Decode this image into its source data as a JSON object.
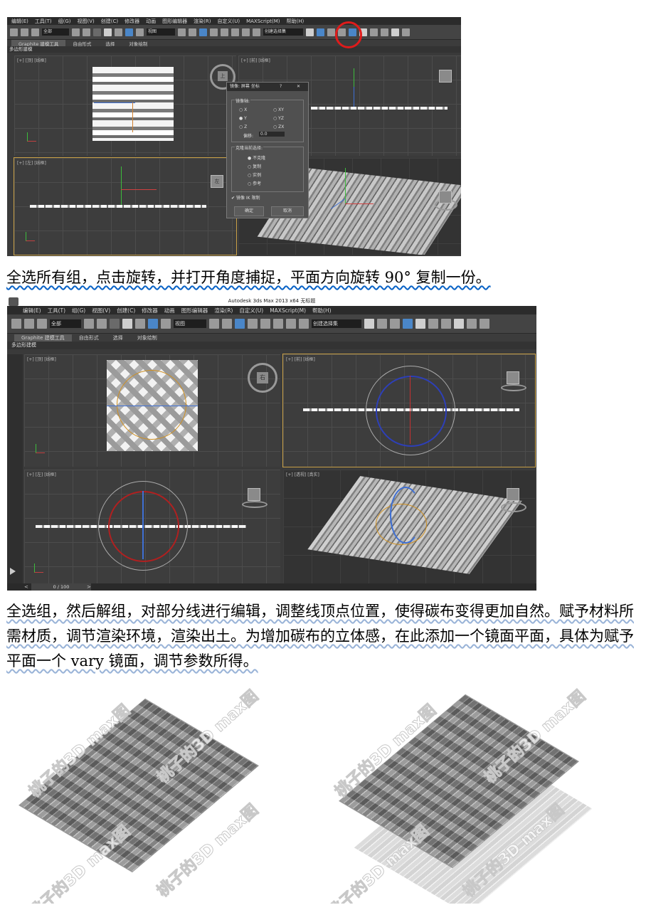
{
  "screenshot1": {
    "menu": [
      "编辑(E)",
      "工具(T)",
      "组(G)",
      "视图(V)",
      "创建(C)",
      "修改器",
      "动画",
      "图形编辑器",
      "渲染(R)",
      "自定义(U)",
      "MAXScript(M)",
      "帮助(H)"
    ],
    "toolbar": {
      "filter_value": "全部",
      "view_value": "视图",
      "selection_set_value": "创建选择集"
    },
    "ribbon_tabs": [
      "Graphite 建模工具",
      "自由形式",
      "选择",
      "对象绘制"
    ],
    "sub_ribbon": "多边形建模",
    "viewport_labels": {
      "top": "[+] [顶] [线框]",
      "front": "[+] [前] [线框]",
      "left": "[+] [左] [线框]"
    },
    "viewcube_labels": {
      "top": "上",
      "left": "左"
    },
    "mirror_dialog": {
      "title": "镜像: 屏幕 坐标",
      "help": "?",
      "axis_group": "镜像轴:",
      "axes": [
        "X",
        "Y",
        "Z",
        "XY",
        "YZ",
        "ZX"
      ],
      "offset_label": "偏移:",
      "offset_value": "0.0",
      "clone_group": "克隆当前选择:",
      "clone_options": [
        "不克隆",
        "复制",
        "实例",
        "参考"
      ],
      "mirror_ik": "镜像 IK 限制",
      "ok": "确定",
      "cancel": "取消"
    },
    "annotation_color": "#e01b1b"
  },
  "paragraph1": "全选所有组，点击旋转，并打开角度捕捉，平面方向旋转 90° 复制一份。",
  "screenshot2": {
    "titlebar": "Autodesk 3ds Max  2013 x64      无标题",
    "menu": [
      "编辑(E)",
      "工具(T)",
      "组(G)",
      "视图(V)",
      "创建(C)",
      "修改器",
      "动画",
      "图形编辑器",
      "渲染(R)",
      "自定义(U)",
      "MAXScript(M)",
      "帮助(H)"
    ],
    "toolbar": {
      "filter_value": "全部",
      "view_value": "视图",
      "selection_set_value": "创建选择集"
    },
    "ribbon_tabs": [
      "Graphite 建模工具",
      "自由形式",
      "选择",
      "对象绘制"
    ],
    "sub_ribbon": "多边形建模",
    "viewport_labels": {
      "top": "[+] [顶] [线框]",
      "front": "[+] [前] [线框]",
      "left": "[+] [左] [线框]",
      "persp": "[+] [透视] [真实]"
    },
    "viewcube_labels": {
      "top": "右",
      "left": "前"
    },
    "timeline": "0 / 100"
  },
  "paragraph2": "全选组，然后解组，对部分线进行编辑，调整线顶点位置，使得碳布变得更加自然。赋予材料所需材质，调节渲染环境，渲染出土。为增加碳布的立体感，在此添加一个镜面平面，具体为赋予平面一个 vary 镜面，调节参数所得。",
  "renders": {
    "watermark": "桃子的3D max图"
  }
}
